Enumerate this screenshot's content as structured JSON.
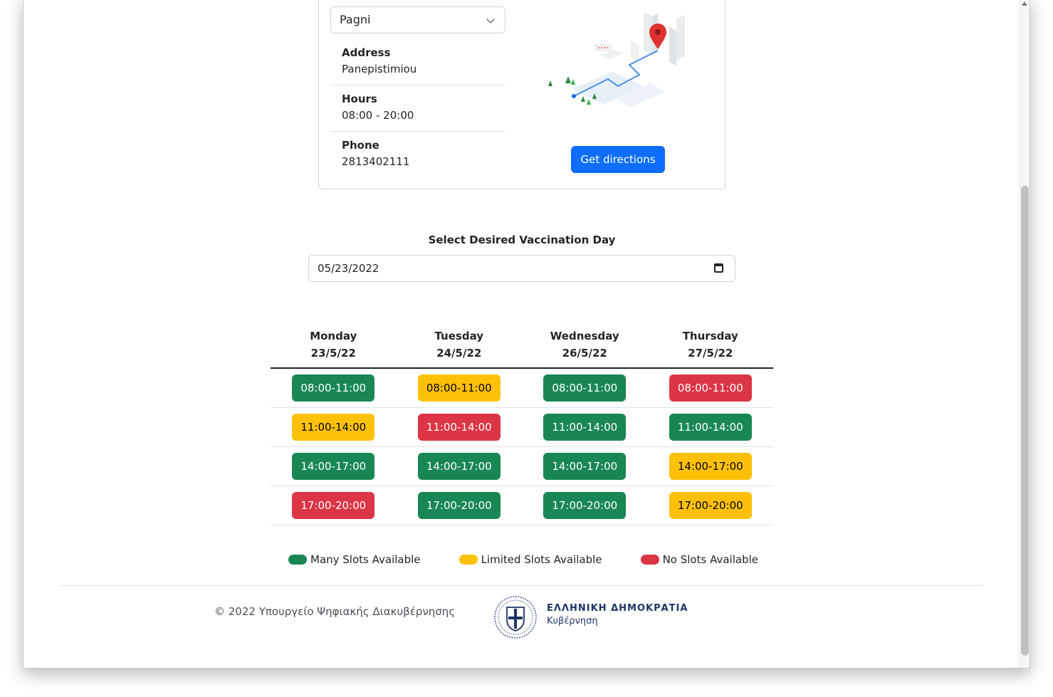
{
  "center": {
    "selected_center": "Pagni",
    "details": [
      {
        "label": "Address",
        "value": "Panepistimiou"
      },
      {
        "label": "Hours",
        "value": "08:00 - 20:00"
      },
      {
        "label": "Phone",
        "value": "2813402111"
      }
    ],
    "directions_button": "Get directions"
  },
  "day_picker": {
    "label": "Select Desired Vaccination Day",
    "value": "05/23/2022"
  },
  "schedule": {
    "days": [
      {
        "name": "Monday",
        "date": "23/5/22"
      },
      {
        "name": "Tuesday",
        "date": "24/5/22"
      },
      {
        "name": "Wednesday",
        "date": "26/5/22"
      },
      {
        "name": "Thursday",
        "date": "27/5/22"
      }
    ],
    "rows": [
      [
        {
          "time": "08:00-11:00",
          "status": "many"
        },
        {
          "time": "08:00-11:00",
          "status": "limited"
        },
        {
          "time": "08:00-11:00",
          "status": "many"
        },
        {
          "time": "08:00-11:00",
          "status": "none"
        }
      ],
      [
        {
          "time": "11:00-14:00",
          "status": "limited"
        },
        {
          "time": "11:00-14:00",
          "status": "none"
        },
        {
          "time": "11:00-14:00",
          "status": "many"
        },
        {
          "time": "11:00-14:00",
          "status": "many"
        }
      ],
      [
        {
          "time": "14:00-17:00",
          "status": "many"
        },
        {
          "time": "14:00-17:00",
          "status": "many"
        },
        {
          "time": "14:00-17:00",
          "status": "many"
        },
        {
          "time": "14:00-17:00",
          "status": "limited"
        }
      ],
      [
        {
          "time": "17:00-20:00",
          "status": "none"
        },
        {
          "time": "17:00-20:00",
          "status": "many"
        },
        {
          "time": "17:00-20:00",
          "status": "many"
        },
        {
          "time": "17:00-20:00",
          "status": "limited"
        }
      ]
    ]
  },
  "legend": {
    "many": "Many Slots Available",
    "limited": "Limited Slots Available",
    "none": "No Slots Available"
  },
  "colors": {
    "many": "#198754",
    "limited": "#ffc107",
    "none": "#dc3545",
    "primary": "#0d6efd"
  },
  "footer": {
    "copyright": "© 2022 Υπουργείο Ψηφιακής Διακυβέρνησης",
    "gov_title": "ΕΛΛΗΝΙΚΗ ΔΗΜΟΚΡΑΤΙΑ",
    "gov_subtitle": "Κυβέρνηση"
  }
}
